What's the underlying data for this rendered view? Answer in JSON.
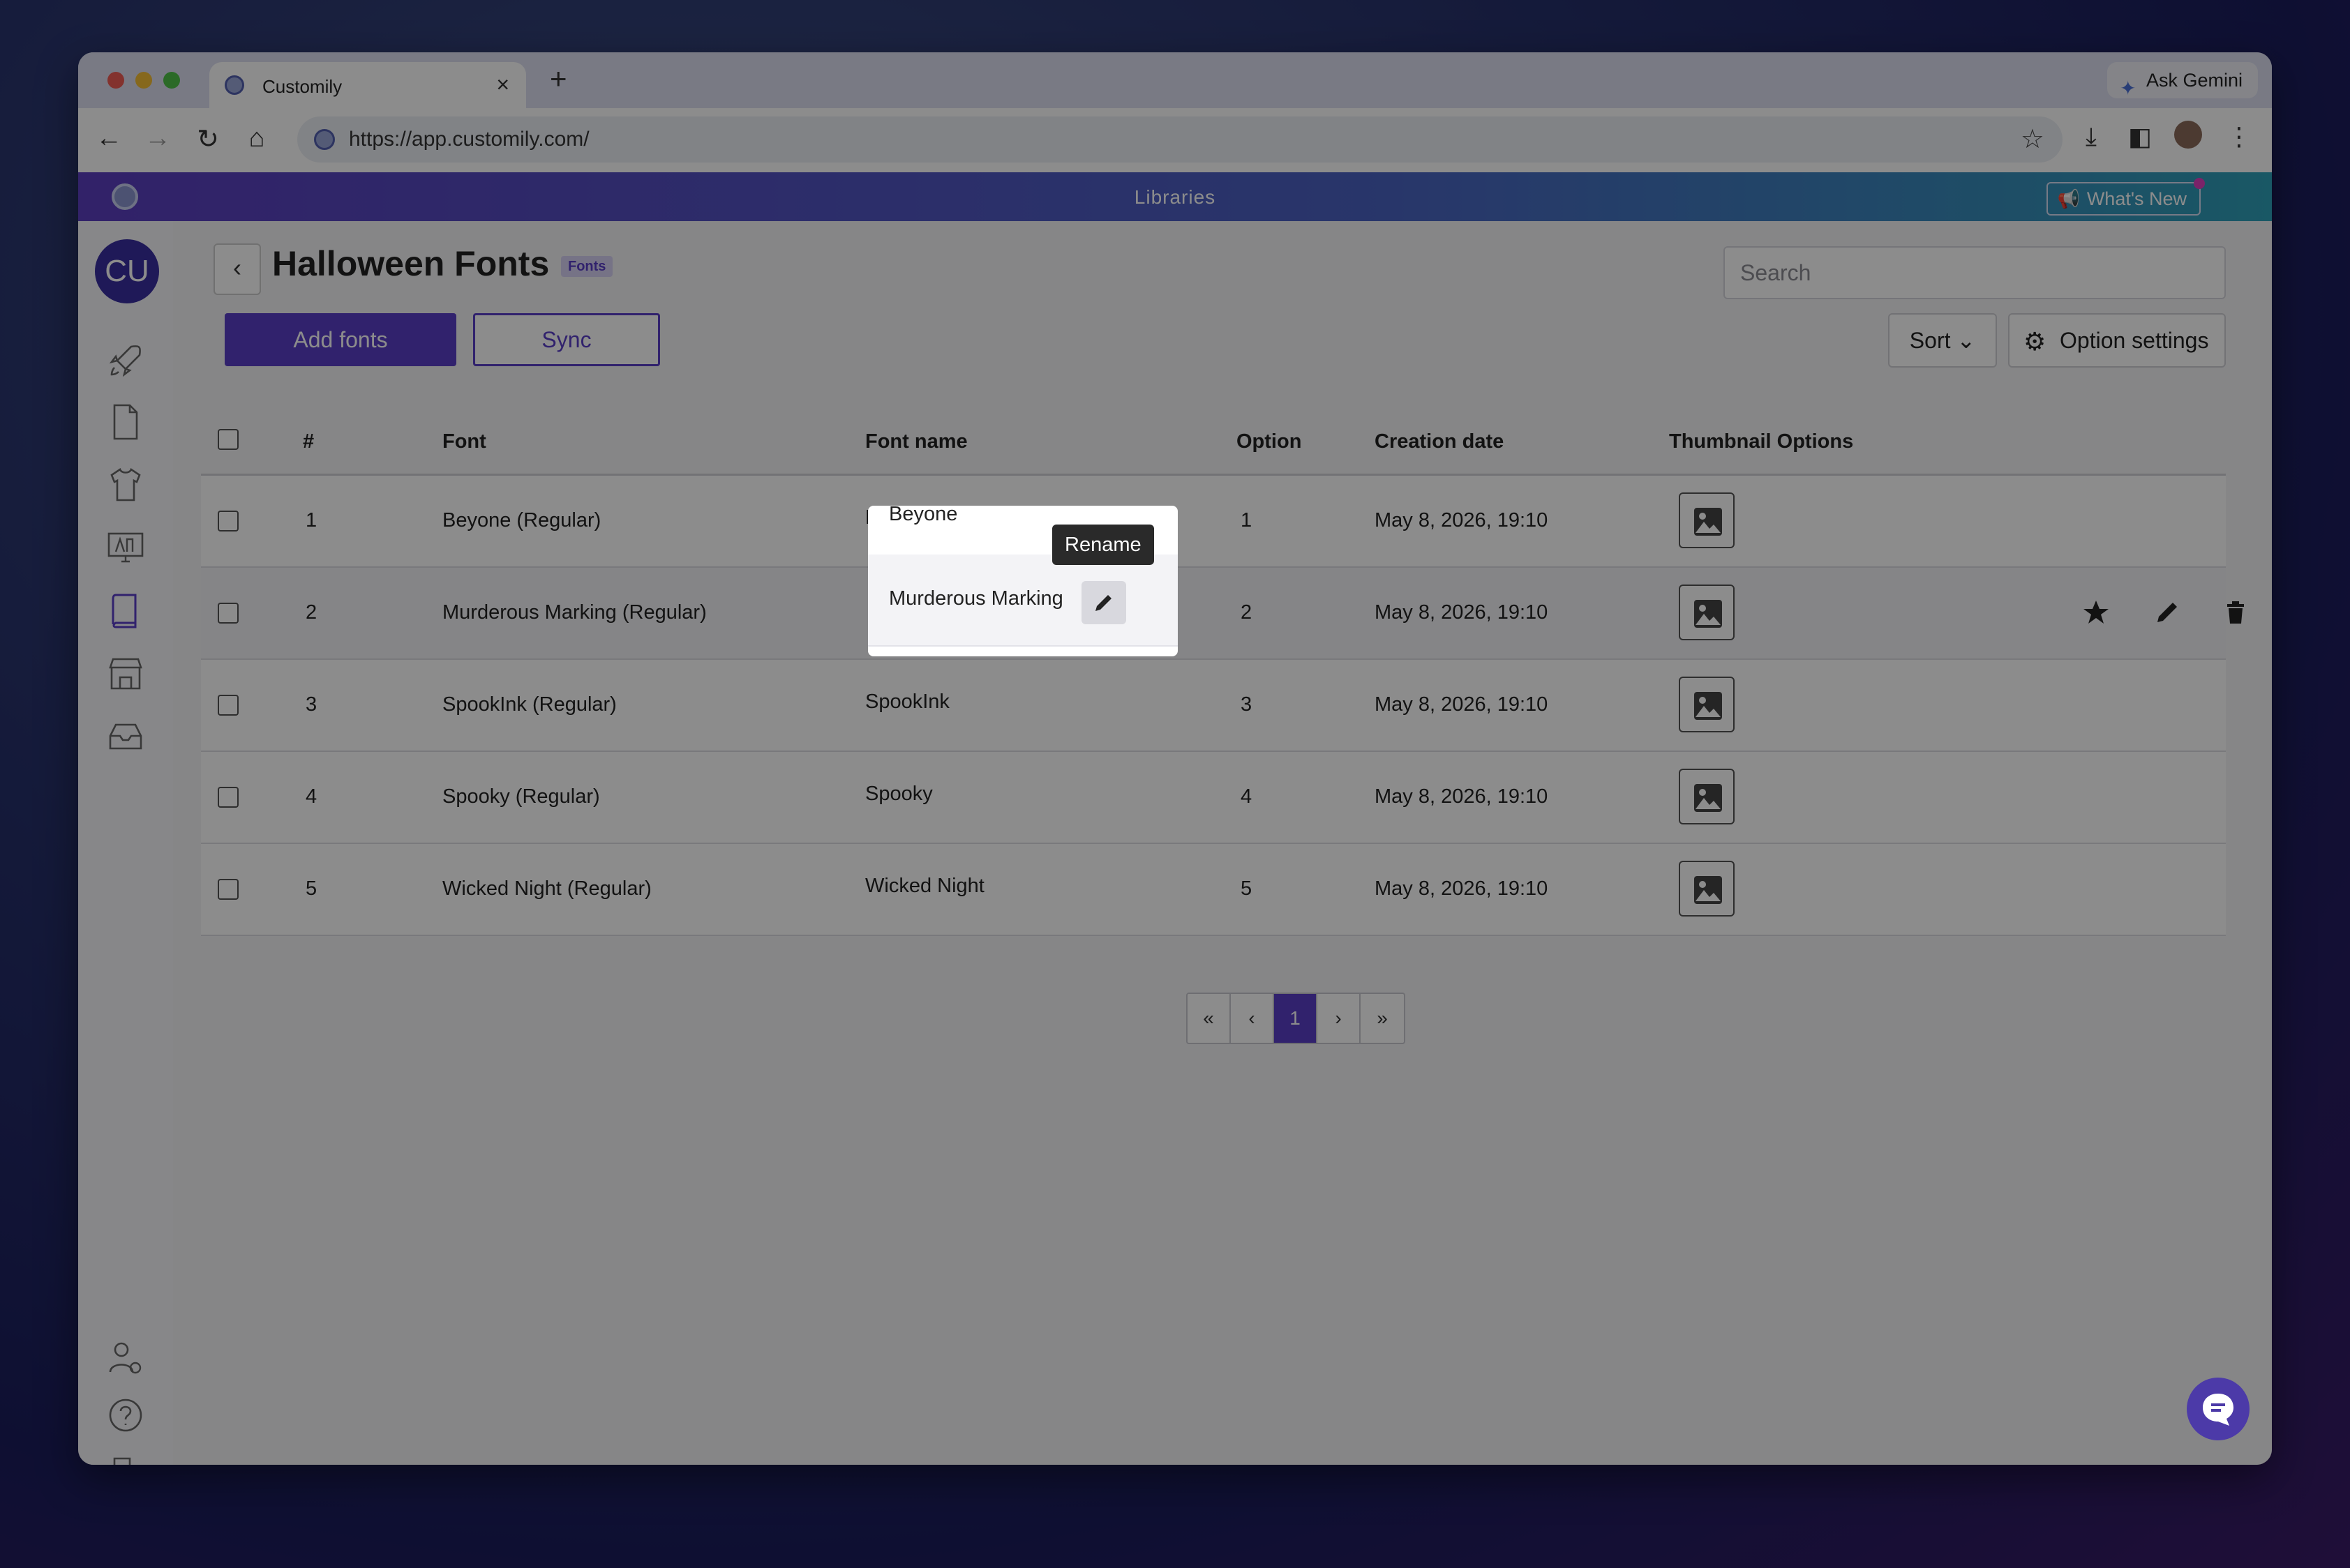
{
  "browser": {
    "tab_title": "Customily",
    "url": "https://app.customily.com/",
    "ask_gemini": "Ask Gemini"
  },
  "app": {
    "header_title": "Libraries",
    "whats_new": "What's New",
    "user_initials": "CU"
  },
  "page": {
    "title": "Halloween Fonts",
    "badge": "Fonts",
    "search_placeholder": "Search",
    "add_fonts": "Add fonts",
    "sync": "Sync",
    "sort": "Sort",
    "option_settings": "Option settings"
  },
  "table": {
    "headers": [
      "#",
      "Font",
      "Font name",
      "Option",
      "Creation date",
      "Thumbnail Options"
    ],
    "rows": [
      {
        "num": "1",
        "font": "Beyone (Regular)",
        "name": "Beyone",
        "option": "1",
        "date": "May 8, 2026, 19:10"
      },
      {
        "num": "2",
        "font": "Murderous Marking (Regular)",
        "name": "Murderous Marking",
        "option": "2",
        "date": "May 8, 2026, 19:10"
      },
      {
        "num": "3",
        "font": "SpookInk (Regular)",
        "name": "SpookInk",
        "option": "3",
        "date": "May 8, 2026, 19:10"
      },
      {
        "num": "4",
        "font": "Spooky (Regular)",
        "name": "Spooky",
        "option": "4",
        "date": "May 8, 2026, 19:10"
      },
      {
        "num": "5",
        "font": "Wicked Night (Regular)",
        "name": "Wicked Night",
        "option": "5",
        "date": "May 8, 2026, 19:10"
      }
    ]
  },
  "tooltip": {
    "rename": "Rename"
  },
  "pagination": {
    "first": "«",
    "prev": "‹",
    "current": "1",
    "next": "›",
    "last": "»"
  },
  "colors": {
    "accent": "#5a3ec7",
    "header_start": "#5b3ebf",
    "header_end": "#2fa0b8"
  }
}
